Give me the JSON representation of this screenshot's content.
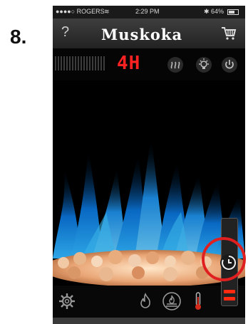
{
  "step_label": "8.",
  "status": {
    "carrier": "●●●●○ ROGERS",
    "wifi": "≋",
    "time": "2:29 PM",
    "bluetooth": "✱",
    "battery_text": "64%",
    "battery_level": 0.64
  },
  "topbar": {
    "help_label": "?",
    "brand": "Muskoka",
    "cart_icon": "cart-icon"
  },
  "controls": {
    "temperature_display": "4H",
    "heat_icon": "heat-icon",
    "light_icon": "light-bulb-icon",
    "power_icon": "power-icon"
  },
  "bottom": {
    "settings_icon": "gear-icon",
    "flame_icon": "flame-icon",
    "ember_icon": "ember-bed-icon",
    "thermometer_icon": "thermometer-icon"
  },
  "timer": {
    "icon": "timer-clock-icon",
    "active_bars": 2
  },
  "colors": {
    "flame_blue": "#1fa4ff",
    "accent_red": "#ff2222",
    "highlight_red": "#e02020"
  }
}
